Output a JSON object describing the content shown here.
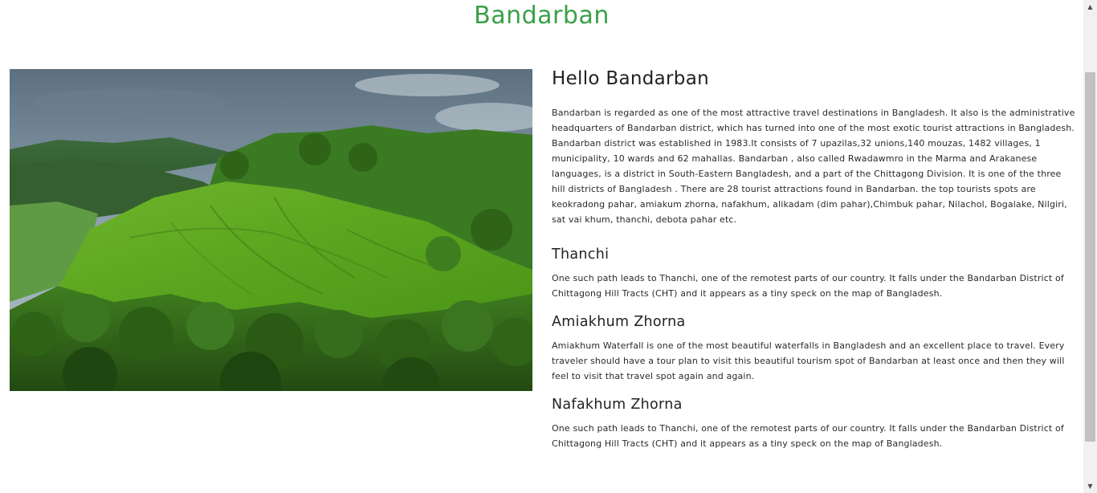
{
  "page": {
    "title": "Bandarban",
    "title_color": "#3aa048"
  },
  "hero_image": {
    "icon": "landscape-photo",
    "subject": "green hills"
  },
  "content": {
    "heading": "Hello Bandarban",
    "intro": "Bandarban is regarded as one of the most attractive travel destinations in Bangladesh. It also is the administrative headquarters of Bandarban district, which has turned into one of the most exotic tourist attractions in Bangladesh. Bandarban district was established in 1983.It consists of 7 upazilas,32 unions,140 mouzas, 1482 villages, 1 municipality, 10 wards and 62 mahallas. Bandarban , also called Rwadawmro in the Marma and Arakanese languages, is a district in South-Eastern Bangladesh, and a part of the Chittagong Division. It is one of the three hill districts of Bangladesh . There are 28 tourist attractions found in Bandarban. the top tourists spots are keokradong pahar, amiakum zhorna, nafakhum, alikadam (dim pahar),Chimbuk pahar, Nilachol, Bogalake, Nilgiri, sat vai khum, thanchi, debota pahar etc.",
    "sections": [
      {
        "title": "Thanchi",
        "text": "One such path leads to Thanchi, one of the remotest parts of our country. It falls under the Bandarban District of Chittagong Hill Tracts (CHT) and it appears as a tiny speck on the map of Bangladesh."
      },
      {
        "title": "Amiakhum Zhorna",
        "text": "Amiakhum Waterfall is one of the most beautiful waterfalls in Bangladesh and an excellent place to travel. Every traveler should have a tour plan to visit this beautiful tourism spot of Bandarban at least once and then they will feel to visit that travel spot again and again."
      },
      {
        "title": "Nafakhum Zhorna",
        "text": "One such path leads to Thanchi, one of the remotest parts of our country. It falls under the Bandarban District of Chittagong Hill Tracts (CHT) and it appears as a tiny speck on the map of Bangladesh."
      }
    ]
  },
  "scrollbar": {
    "up_icon": "arrow-up-icon",
    "down_icon": "arrow-down-icon"
  }
}
